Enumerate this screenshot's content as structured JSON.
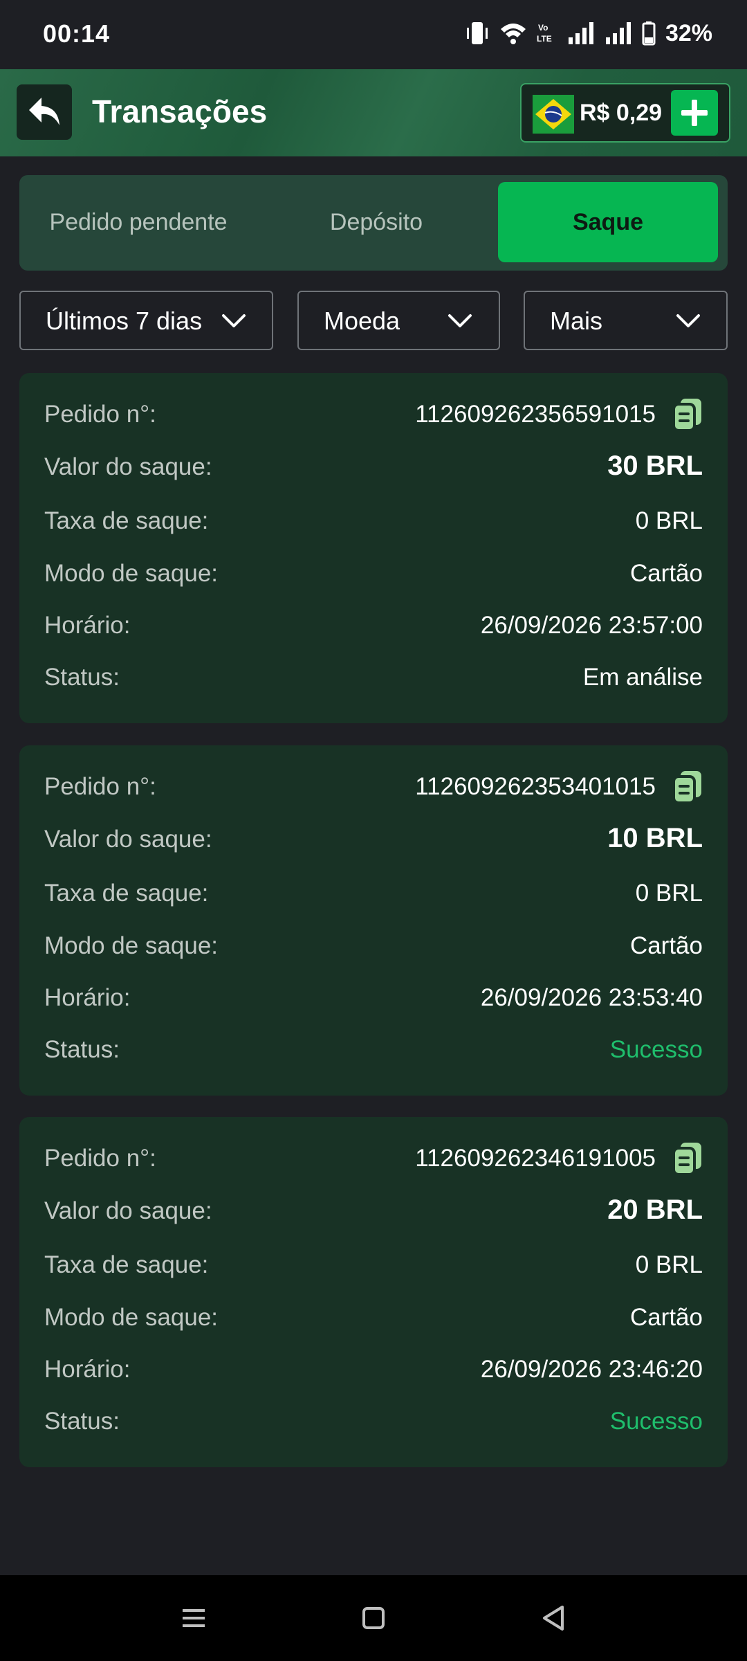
{
  "status_bar": {
    "time": "00:14",
    "battery": "32%",
    "icons": [
      "vibrate-icon",
      "wifi-icon",
      "volte-icon",
      "signal-icon",
      "signal-icon",
      "battery-icon"
    ]
  },
  "header": {
    "title": "Transações",
    "back_icon": "back-arrow-icon",
    "balance": "R$ 0,29",
    "flag_icon": "brazil-flag-icon",
    "add_icon": "plus-icon"
  },
  "tabs": [
    {
      "label": "Pedido pendente",
      "active": false
    },
    {
      "label": "Depósito",
      "active": false
    },
    {
      "label": "Saque",
      "active": true
    }
  ],
  "filters": {
    "days": "Últimos 7 dias",
    "coin": "Moeda",
    "more": "Mais"
  },
  "labels": {
    "order": "Pedido n°:",
    "amount": "Valor do saque:",
    "fee": "Taxa de saque:",
    "mode": "Modo de saque:",
    "time": "Horário:",
    "status": "Status:"
  },
  "transactions": [
    {
      "order": "112609262356591015",
      "amount": "30 BRL",
      "fee": "0 BRL",
      "mode": "Cartão",
      "time": "26/09/2026 23:57:00",
      "status": "Em análise"
    },
    {
      "order": "112609262353401015",
      "amount": "10 BRL",
      "fee": "0 BRL",
      "mode": "Cartão",
      "time": "26/09/2026 23:53:40",
      "status": "Sucesso"
    },
    {
      "order": "112609262346191005",
      "amount": "20 BRL",
      "fee": "0 BRL",
      "mode": "Cartão",
      "time": "26/09/2026 23:46:20",
      "status": "Sucesso"
    }
  ],
  "colors": {
    "accent": "#06b652",
    "success": "#1fbe6c",
    "card_bg": "#183225",
    "page_bg": "#1e1f24",
    "copy_icon": "#9fd89a"
  },
  "nav_bar": [
    "menu-icon",
    "home-icon",
    "back-icon"
  ]
}
